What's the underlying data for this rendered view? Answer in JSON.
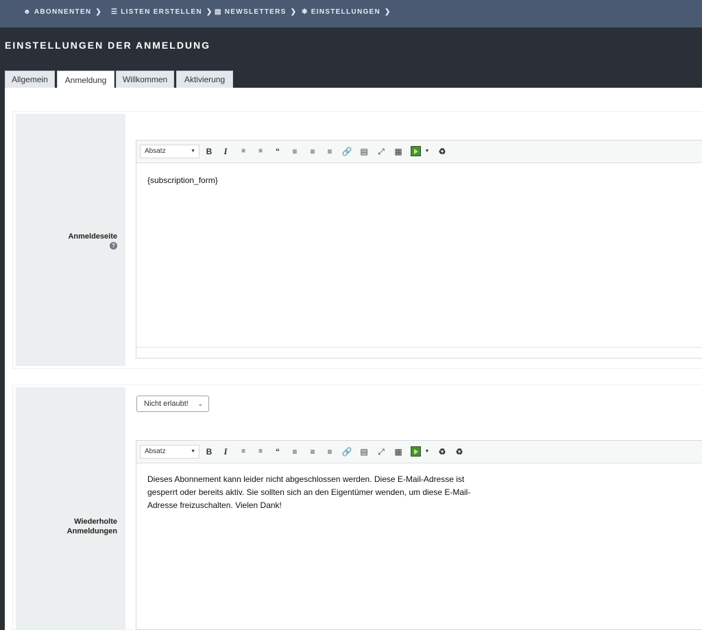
{
  "nav": {
    "items": [
      {
        "label": "ABONNENTEN",
        "icon": "users-icon"
      },
      {
        "label": "LISTEN ERSTELLEN",
        "icon": "list-icon"
      },
      {
        "label": "NEWSLETTERS",
        "icon": "newsletter-icon"
      },
      {
        "label": "EINSTELLUNGEN",
        "icon": "gear-icon"
      }
    ]
  },
  "page": {
    "title": "EINSTELLUNGEN DER ANMELDUNG"
  },
  "tabs": [
    {
      "label": "Allgemein",
      "active": false
    },
    {
      "label": "Anmeldung",
      "active": true
    },
    {
      "label": "Willkommen",
      "active": false
    },
    {
      "label": "Aktivierung",
      "active": false
    }
  ],
  "section1": {
    "label": "Anmeldeseite",
    "editor": {
      "format": "Absatz",
      "content": "{subscription_form}"
    }
  },
  "section2": {
    "label_line1": "Wiederholte",
    "label_line2": "Anmeldungen",
    "select_value": "Nicht erlaubt!",
    "editor": {
      "format": "Absatz",
      "content_line1": "Dieses Abonnement kann leider nicht abgeschlossen werden. Diese E-Mail-Adresse ist",
      "content_line2": "gesperrt oder bereits aktiv. Sie sollten sich an den Eigentümer wenden, um diese E-Mail-",
      "content_line3": "Adresse freizuschalten. Vielen Dank!"
    }
  },
  "colors": {
    "nav_bg": "#4a5a72",
    "header_bg": "#2b3038",
    "label_bg": "#ecefef"
  }
}
